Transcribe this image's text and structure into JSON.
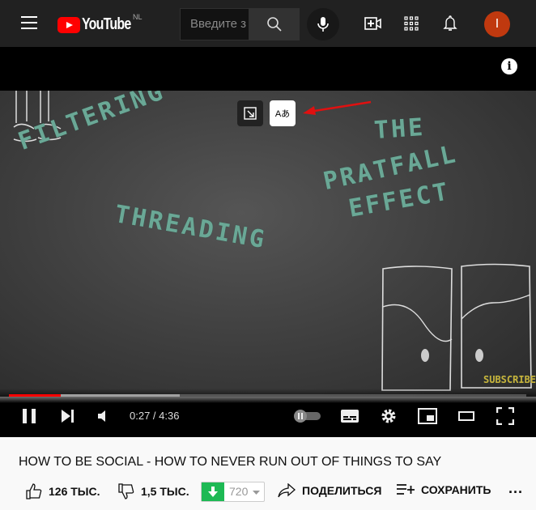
{
  "header": {
    "logo": "YouTube",
    "region": "NL",
    "search_placeholder": "Введите з",
    "avatar_letter": "I"
  },
  "video": {
    "chalk_words": [
      "FILTERING",
      "THREADING",
      "THE",
      "PRATFALL",
      "EFFECT",
      "SUBSCRIBE"
    ],
    "progress": {
      "current": "0:27",
      "duration": "4:36",
      "time_display": "0:27 / 4:36",
      "played_pct": 10,
      "buffered_pct": 33
    },
    "accent": "#ff0000"
  },
  "title": "HOW TO BE SOCIAL - HOW TO NEVER RUN OUT OF THINGS TO SAY",
  "actions": {
    "likes": "126 ТЫС.",
    "dislikes": "1,5 ТЫС.",
    "download_quality": "720",
    "share": "ПОДЕЛИТЬСЯ",
    "save": "СОХРАНИТЬ"
  }
}
